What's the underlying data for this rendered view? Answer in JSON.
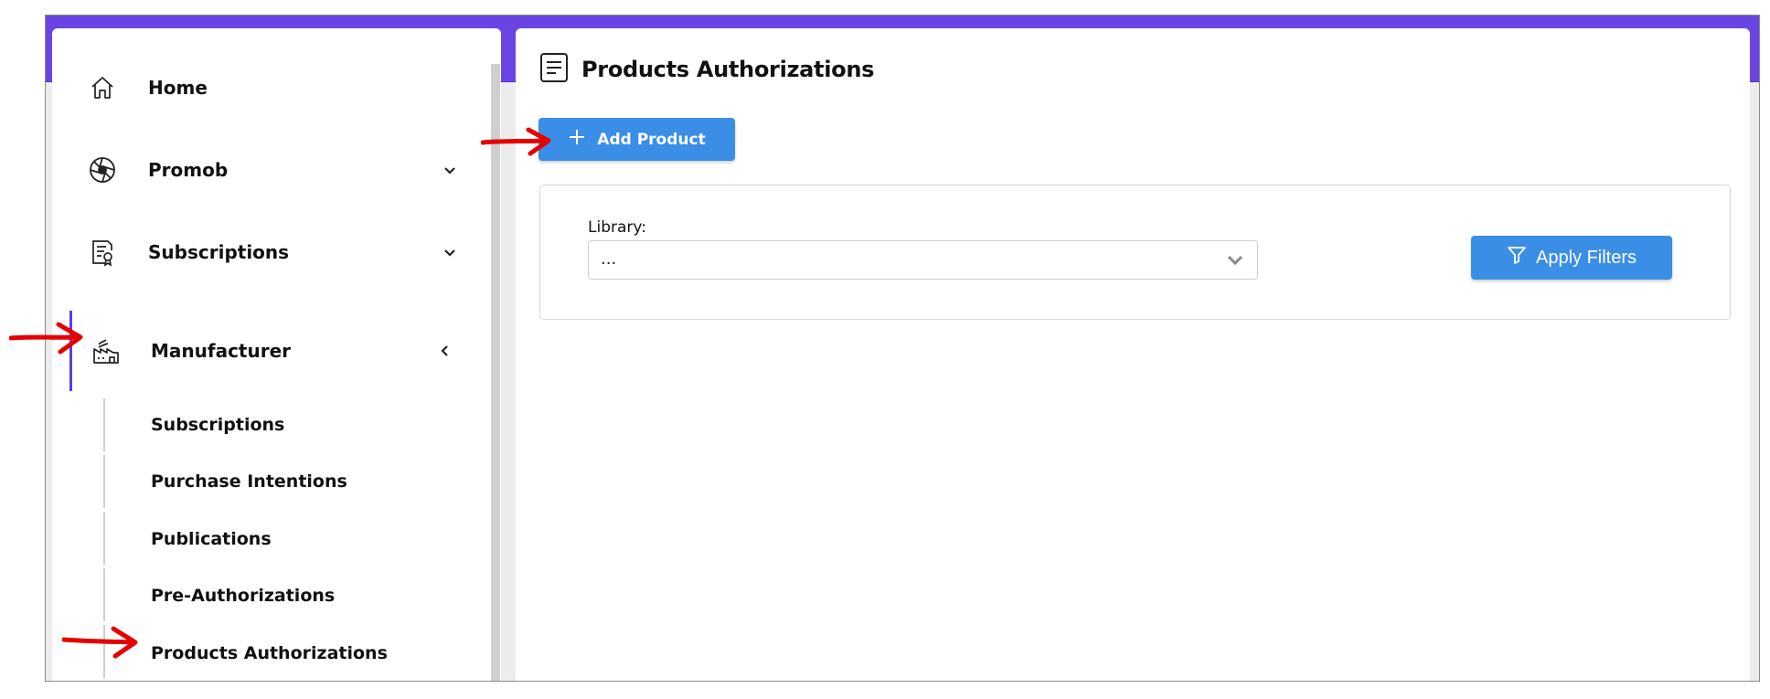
{
  "sidebar": {
    "items": [
      {
        "label": "Home",
        "icon": "home-icon"
      },
      {
        "label": "Promob",
        "icon": "aperture-icon",
        "chevron": "chevron-down-icon"
      },
      {
        "label": "Subscriptions",
        "icon": "certificate-document-icon",
        "chevron": "chevron-down-icon"
      },
      {
        "label": "Manufacturer",
        "icon": "factory-icon",
        "chevron": "chevron-left-icon",
        "active": true
      }
    ],
    "manufacturer_submenu": [
      "Subscriptions",
      "Purchase Intentions",
      "Publications",
      "Pre-Authorizations",
      "Products Authorizations"
    ],
    "selected_submenu": "Products Authorizations"
  },
  "main": {
    "title": "Products Authorizations",
    "title_icon": "document-lines-icon",
    "add_button_label": "Add Product",
    "filters": {
      "library_label": "Library:",
      "library_value": "...",
      "apply_label": "Apply Filters"
    }
  },
  "colors": {
    "accent_purple": "#6b45e4",
    "button_blue": "#3a8ee6",
    "annotation_red": "#e60000"
  }
}
